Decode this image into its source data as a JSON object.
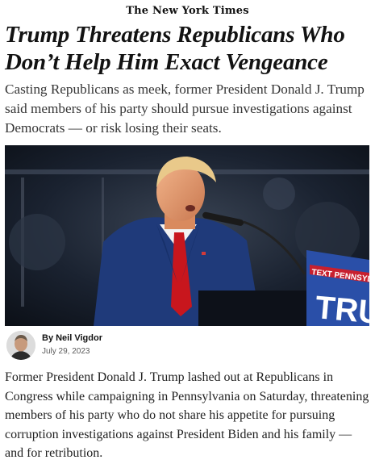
{
  "masthead": {
    "title": "The New York Times"
  },
  "article": {
    "headline": "Trump Threatens Republicans Who Don’t Help Him Exact Vengeance",
    "summary": "Casting Republicans as meek, former President Donald J. Trump said members of his party should pursue investigations against Democrats — or risk losing their seats.",
    "photo": {
      "sign_text_line1": "TEXT PENNSYLVA",
      "sign_text_line2": "TRU",
      "colors": {
        "sign_blue": "#2a4fa8",
        "sign_red": "#c8202e",
        "suit": "#1f3a7a",
        "tie": "#c8161d"
      }
    },
    "byline": "By Neil Vigdor",
    "date": "July 29, 2023",
    "body": "Former President Donald J. Trump lashed out at Republicans in Congress while campaigning in Pennsylvania on Saturday, threatening members of his party who do not share his appetite for pursuing corruption investigations against President Biden and his family — and for retribution."
  }
}
